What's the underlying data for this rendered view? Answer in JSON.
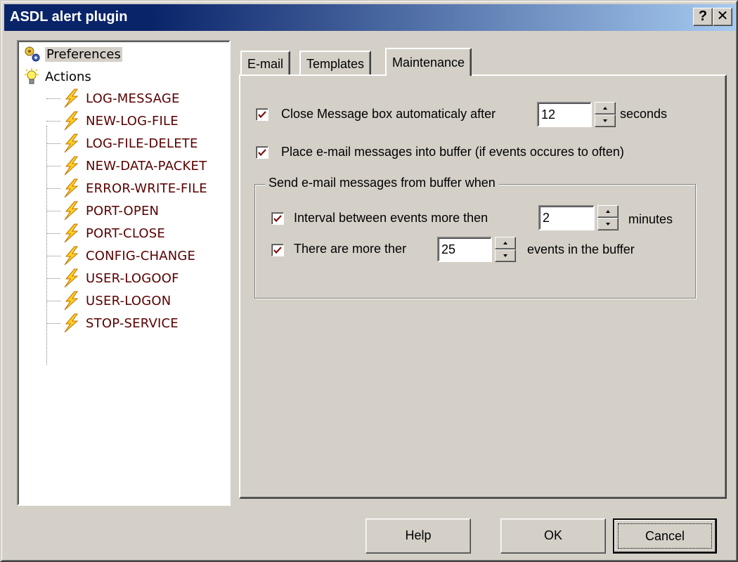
{
  "window": {
    "title": "ASDL alert plugin",
    "help_label": "?",
    "close_label": "✕"
  },
  "tree": {
    "roots": [
      {
        "label": "Preferences",
        "icon": "preferences-icon"
      },
      {
        "label": "Actions",
        "icon": "lightbulb-icon"
      }
    ],
    "actions": [
      "LOG-MESSAGE",
      "NEW-LOG-FILE",
      "LOG-FILE-DELETE",
      "NEW-DATA-PACKET",
      "ERROR-WRITE-FILE",
      "PORT-OPEN",
      "PORT-CLOSE",
      "CONFIG-CHANGE",
      "USER-LOGOOF",
      "USER-LOGON",
      "STOP-SERVICE"
    ]
  },
  "tabs": [
    {
      "label": "E-mail",
      "active": false
    },
    {
      "label": "Templates",
      "active": false
    },
    {
      "label": "Maintenance",
      "active": true
    }
  ],
  "maintenance": {
    "close_box": {
      "label": "Close Message box automaticaly after",
      "value": "12",
      "suffix": "seconds",
      "checked": true
    },
    "buffer": {
      "label": "Place e-mail messages into buffer (if events occures to often)",
      "checked": true
    },
    "group": {
      "legend": "Send e-mail messages from buffer when",
      "interval": {
        "label": "Interval between events more then",
        "value": "2",
        "suffix": "minutes",
        "checked": true
      },
      "count": {
        "label": "There are more ther",
        "value": "25",
        "suffix": "events in the buffer",
        "checked": true
      }
    }
  },
  "buttons": {
    "help": "Help",
    "ok": "OK",
    "cancel": "Cancel"
  },
  "colors": {
    "title_gradient_start": "#0a246a",
    "title_gradient_end": "#a6caf0",
    "tree_label": "#5a0000",
    "check": "#7a1010"
  }
}
